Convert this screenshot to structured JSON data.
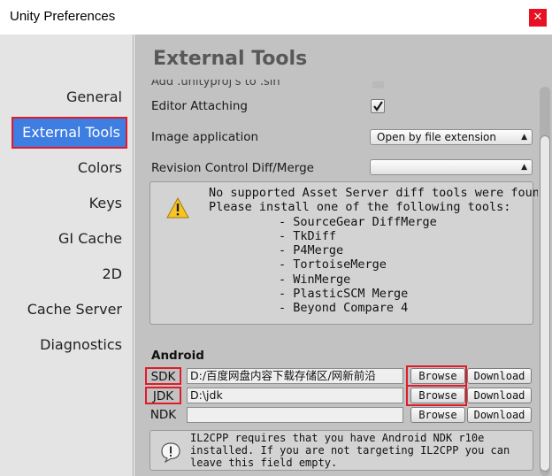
{
  "window": {
    "title": "Unity Preferences",
    "close_glyph": "✕"
  },
  "sidebar": {
    "items": [
      {
        "label": "General"
      },
      {
        "label": "External Tools"
      },
      {
        "label": "Colors"
      },
      {
        "label": "Keys"
      },
      {
        "label": "GI Cache"
      },
      {
        "label": "2D"
      },
      {
        "label": "Cache Server"
      },
      {
        "label": "Diagnostics"
      }
    ],
    "selected": "External Tools"
  },
  "main": {
    "title": "External Tools",
    "cut_row_label": "Add .unityproj's to .sln",
    "editor_attaching": {
      "label": "Editor Attaching",
      "checked": true
    },
    "image_application": {
      "label": "Image application",
      "value": "Open by file extension"
    },
    "revision_control": {
      "label": "Revision Control Diff/Merge",
      "value": ""
    },
    "diff_help": {
      "lines": [
        "No supported Asset Server diff tools were found.",
        "Please install one of the following tools:"
      ],
      "tools": [
        "- SourceGear DiffMerge",
        "- TkDiff",
        "- P4Merge",
        "- TortoiseMerge",
        "- WinMerge",
        "- PlasticSCM Merge",
        "- Beyond Compare 4"
      ]
    },
    "android": {
      "section_title": "Android",
      "sdk": {
        "label": "SDK",
        "path": "D:/百度网盘内容下载存储区/网新前沿"
      },
      "jdk": {
        "label": "JDK",
        "path": "D:\\jdk"
      },
      "ndk": {
        "label": "NDK",
        "path": ""
      },
      "browse_label": "Browse",
      "download_label": "Download",
      "il2cpp_note": "IL2CPP requires that you have Android NDK r10e installed. If you are not targeting IL2CPP you can leave this field empty."
    }
  },
  "colors": {
    "sidebar_bg": "#e4e4e4",
    "content_bg": "#c2c2c2",
    "selected_bg": "#3e7de2",
    "highlight_outline": "#e01c2a",
    "close_bg": "#e81123"
  }
}
